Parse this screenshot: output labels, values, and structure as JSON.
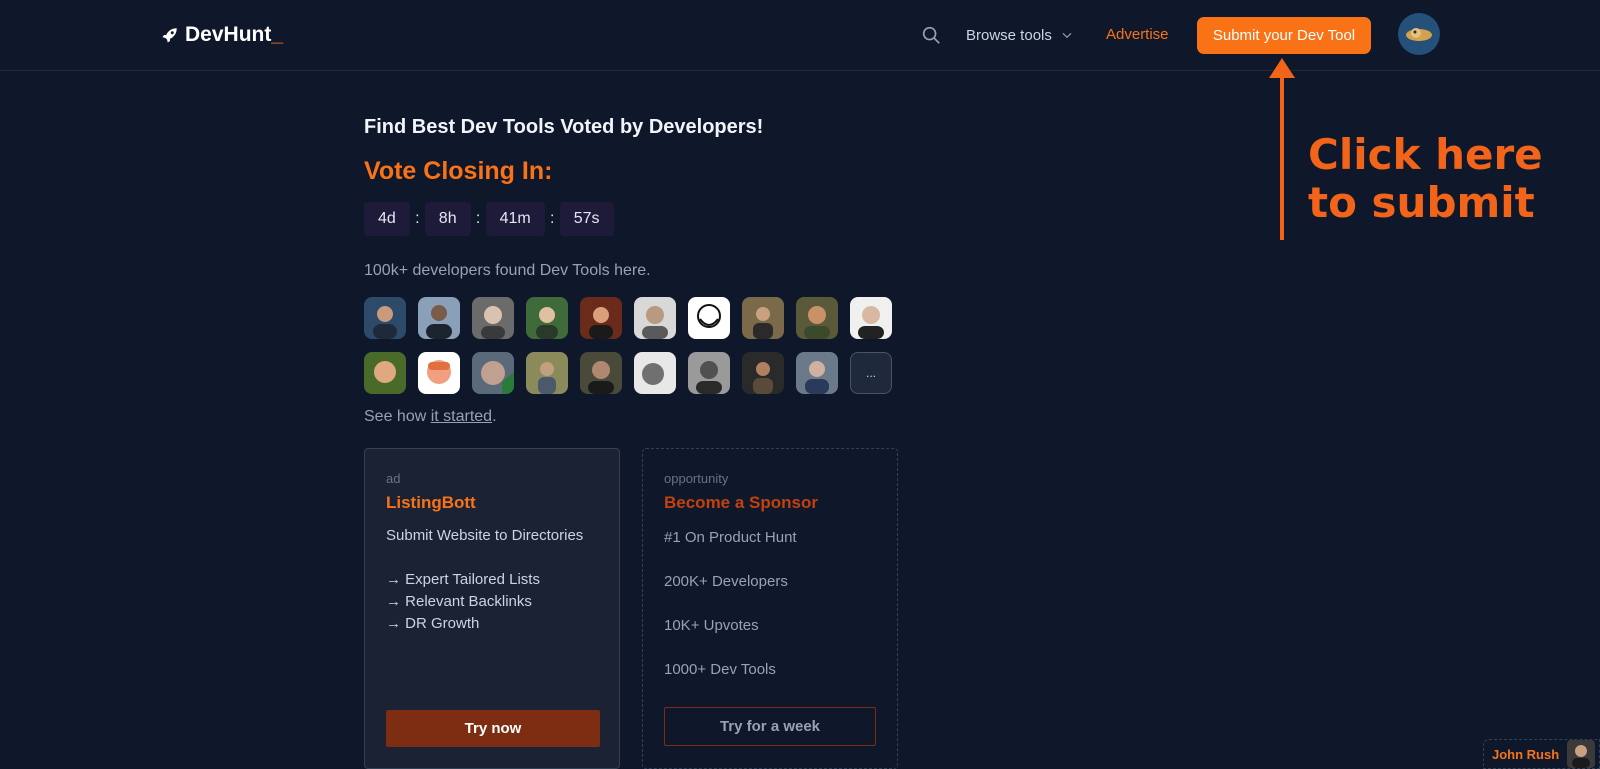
{
  "header": {
    "logo_text": "DevHunt",
    "logo_cursor": "_",
    "browse_label": "Browse tools",
    "advertise_label": "Advertise",
    "submit_label": "Submit your Dev Tool"
  },
  "annotation": {
    "line1": "Click here",
    "line2": "to submit",
    "color": "#f26419"
  },
  "hero": {
    "tagline": "Find Best Dev Tools Voted by Developers!",
    "vote_closing": "Vote Closing In:",
    "countdown": {
      "days": "4d",
      "hours": "8h",
      "minutes": "41m",
      "seconds": "57s",
      "separator": ":"
    },
    "dev_count": "100k+ developers found Dev Tools here.",
    "more_label": "...",
    "see_how_prefix": "See how ",
    "see_how_link": "it started",
    "see_how_suffix": "."
  },
  "ad_card": {
    "kind": "ad",
    "title": "ListingBott",
    "desc": "Submit Website to Directories",
    "items": [
      "→ Expert Tailored Lists",
      "→ Relevant Backlinks",
      "→ DR Growth"
    ],
    "cta": "Try now"
  },
  "opportunity_card": {
    "kind": "opportunity",
    "title": "Become a Sponsor",
    "items": [
      "#1 On Product Hunt",
      "200K+ Developers",
      "10K+ Upvotes",
      "1000+ Dev Tools"
    ],
    "cta": "Try for a week"
  },
  "author_chip": {
    "name": "John Rush"
  },
  "colors": {
    "background": "#0f172a",
    "accent": "#f97316",
    "ad_button": "#7c2d12"
  }
}
